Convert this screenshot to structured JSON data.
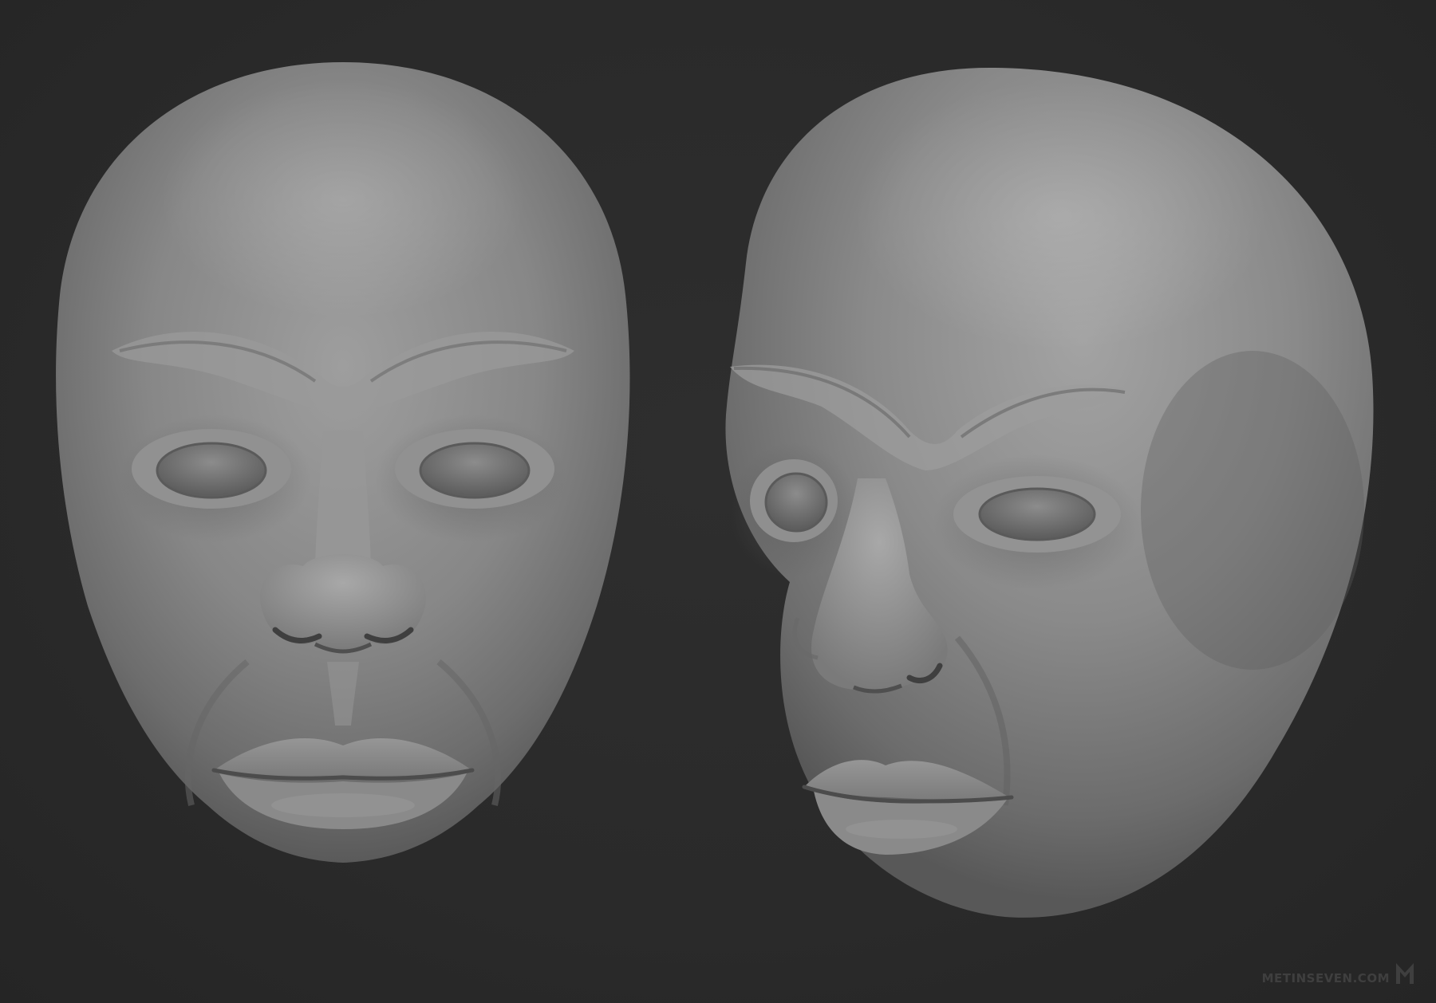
{
  "scene": {
    "background_color": "#2b2b2b",
    "material_color": "#8d8d8d",
    "subjects": [
      "front-view-head-sculpt",
      "three-quarter-view-head-sculpt"
    ]
  },
  "watermark": {
    "text": "METINSEVEN.COM",
    "logo_icon": "m-logo-icon"
  }
}
